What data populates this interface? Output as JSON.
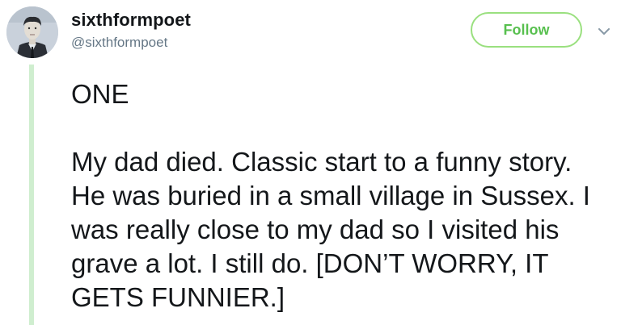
{
  "tweet": {
    "display_name": "sixthformpoet",
    "username": "@sixthformpoet",
    "follow_label": "Follow",
    "heading": "ONE",
    "body": "My dad died. Classic start to a funny story. He was buried in a small village in Sussex. I was really close to my dad so I visited his grave a lot. I still do. [DON’T WORRY, IT GETS FUNNIER.]"
  },
  "icons": {
    "avatar": "avatar-portrait",
    "caret": "chevron-down-icon"
  },
  "colors": {
    "follow_accent": "#58c04f",
    "follow_border": "#9ae07f",
    "thread_line": "#cfeecf",
    "username": "#657786",
    "text": "#14171a"
  }
}
